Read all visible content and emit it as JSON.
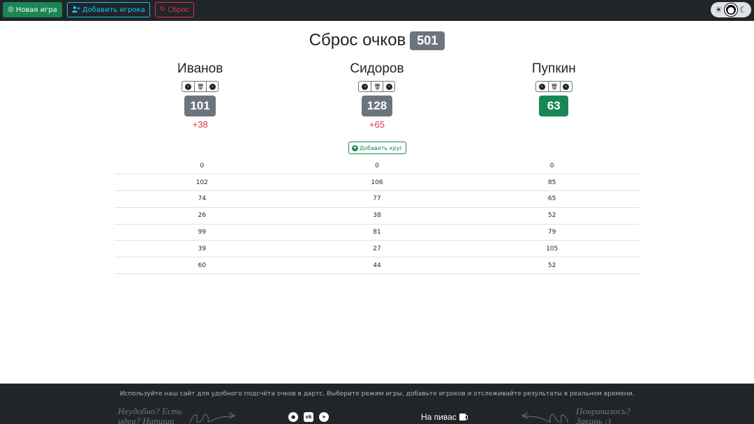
{
  "nav": {
    "new_game_label": "Новая игра",
    "add_player_label": "Добавить игрока",
    "reset_label": "Сброс"
  },
  "theme_toggle": {
    "options": [
      "light",
      "auto",
      "dark"
    ],
    "active": "auto"
  },
  "header": {
    "title": "Сброс очков",
    "target": "501"
  },
  "players": [
    {
      "name": "Иванов",
      "score": "101",
      "diff": "+38",
      "score_color": "#6c757d"
    },
    {
      "name": "Сидоров",
      "score": "128",
      "diff": "+65",
      "score_color": "#6c757d"
    },
    {
      "name": "Пупкин",
      "score": "63",
      "diff": "",
      "score_color": "#198754"
    }
  ],
  "add_round_label": "Добавить круг",
  "rounds": [
    [
      "0",
      "0",
      "0"
    ],
    [
      "102",
      "106",
      "85"
    ],
    [
      "74",
      "77",
      "65"
    ],
    [
      "26",
      "38",
      "52"
    ],
    [
      "99",
      "81",
      "79"
    ],
    [
      "39",
      "27",
      "105"
    ],
    [
      "60",
      "44",
      "52"
    ]
  ],
  "footer": {
    "description": "Используйте наш сайт для удобного подсчёта очков в дартс. Выберите режим игры, добавьте игроков и отслеживайте результаты в реальном времени.",
    "left_note": "Неудобно? Есть идеи? Напиши",
    "right_note": "Понравилось? Закинь :)",
    "beer_label": "На пивас",
    "socials": [
      "github-icon",
      "vk-icon",
      "telegram-icon"
    ]
  },
  "colors": {
    "success": "#198754",
    "info": "#0dcaf0",
    "danger": "#dc3545",
    "secondary": "#6c757d",
    "dark": "#212529"
  }
}
